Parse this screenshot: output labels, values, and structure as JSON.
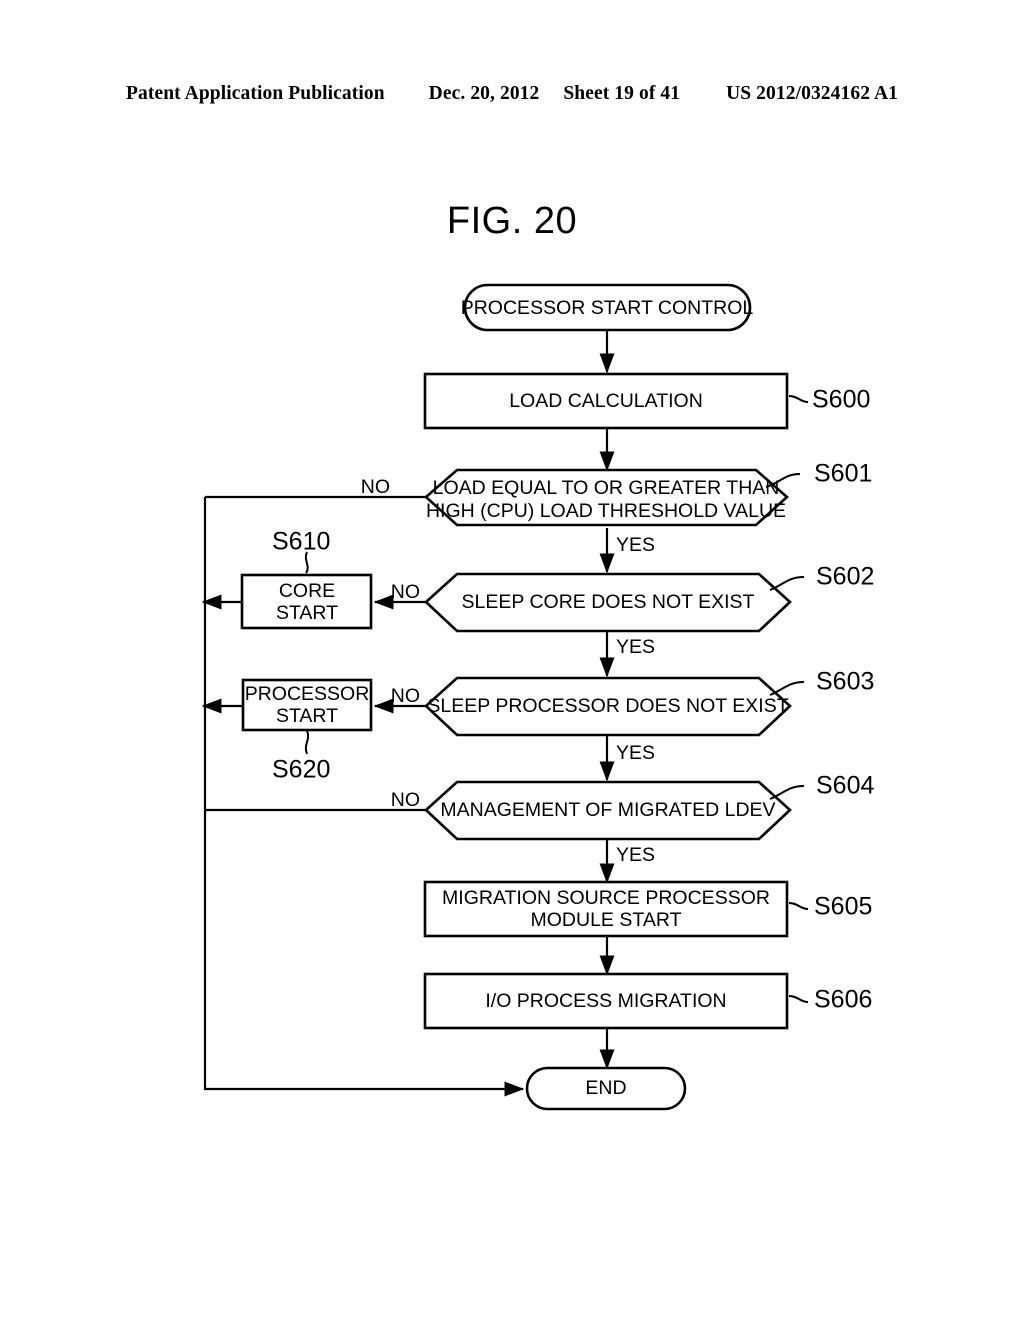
{
  "header": {
    "publication": "Patent Application Publication",
    "date": "Dec. 20, 2012",
    "sheet": "Sheet 19 of 41",
    "patent_number": "US 2012/0324162 A1"
  },
  "figure": {
    "title": "FIG. 20"
  },
  "flowchart": {
    "start_terminal": "PROCESSOR START CONTROL",
    "end_terminal": "END",
    "nodes": [
      {
        "id": "S600",
        "type": "process",
        "label": "LOAD CALCULATION",
        "step": "S600"
      },
      {
        "id": "S601",
        "type": "decision",
        "label_line1": "LOAD EQUAL TO OR GREATER THAN",
        "label_line2": "HIGH (CPU) LOAD THRESHOLD VALUE",
        "step": "S601"
      },
      {
        "id": "S602",
        "type": "decision",
        "label": "SLEEP CORE DOES NOT EXIST",
        "step": "S602"
      },
      {
        "id": "S603",
        "type": "decision",
        "label": "SLEEP PROCESSOR DOES NOT EXIST",
        "step": "S603"
      },
      {
        "id": "S604",
        "type": "decision",
        "label": "MANAGEMENT OF MIGRATED LDEV",
        "step": "S604"
      },
      {
        "id": "S605",
        "type": "process",
        "label_line1": "MIGRATION SOURCE PROCESSOR",
        "label_line2": "MODULE START",
        "step": "S605"
      },
      {
        "id": "S606",
        "type": "process",
        "label": "I/O PROCESS MIGRATION",
        "step": "S606"
      },
      {
        "id": "S610",
        "type": "process",
        "label_line1": "CORE",
        "label_line2": "START",
        "step": "S610"
      },
      {
        "id": "S620",
        "type": "process",
        "label_line1": "PROCESSOR",
        "label_line2": "START",
        "step": "S620"
      }
    ],
    "branches": {
      "no_s601": "NO",
      "yes_s601": "YES",
      "no_s602": "NO",
      "yes_s602": "YES",
      "no_s603": "NO",
      "yes_s603": "YES",
      "no_s604": "NO",
      "yes_s604": "YES"
    }
  },
  "colors": {
    "ink": "#000000",
    "paper": "#ffffff"
  }
}
